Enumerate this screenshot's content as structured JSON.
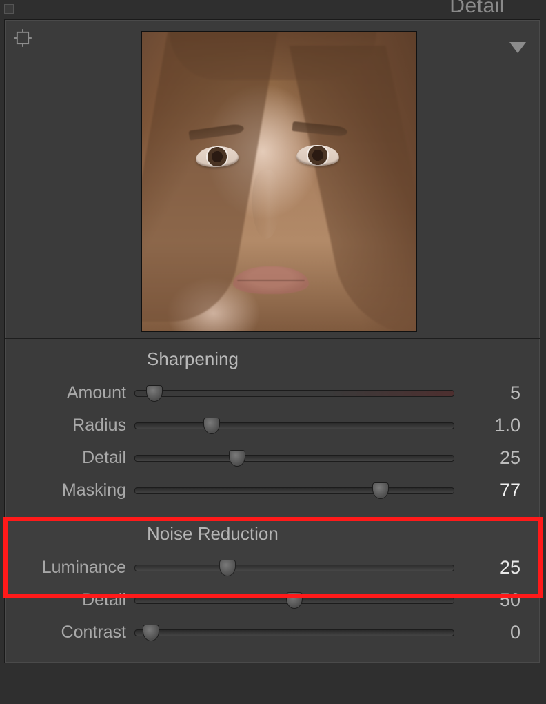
{
  "panel": {
    "title": "Detail"
  },
  "sections": {
    "sharpening": {
      "title": "Sharpening",
      "sliders": {
        "amount": {
          "label": "Amount",
          "value": "5",
          "pos_pct": 6
        },
        "radius": {
          "label": "Radius",
          "value": "1.0",
          "pos_pct": 24
        },
        "detail": {
          "label": "Detail",
          "value": "25",
          "pos_pct": 32
        },
        "masking": {
          "label": "Masking",
          "value": "77",
          "pos_pct": 77
        }
      }
    },
    "noise_reduction": {
      "title": "Noise Reduction",
      "sliders": {
        "luminance": {
          "label": "Luminance",
          "value": "25",
          "pos_pct": 29
        },
        "detail": {
          "label": "Detail",
          "value": "50",
          "pos_pct": 50
        },
        "contrast": {
          "label": "Contrast",
          "value": "0",
          "pos_pct": 5
        }
      }
    }
  }
}
